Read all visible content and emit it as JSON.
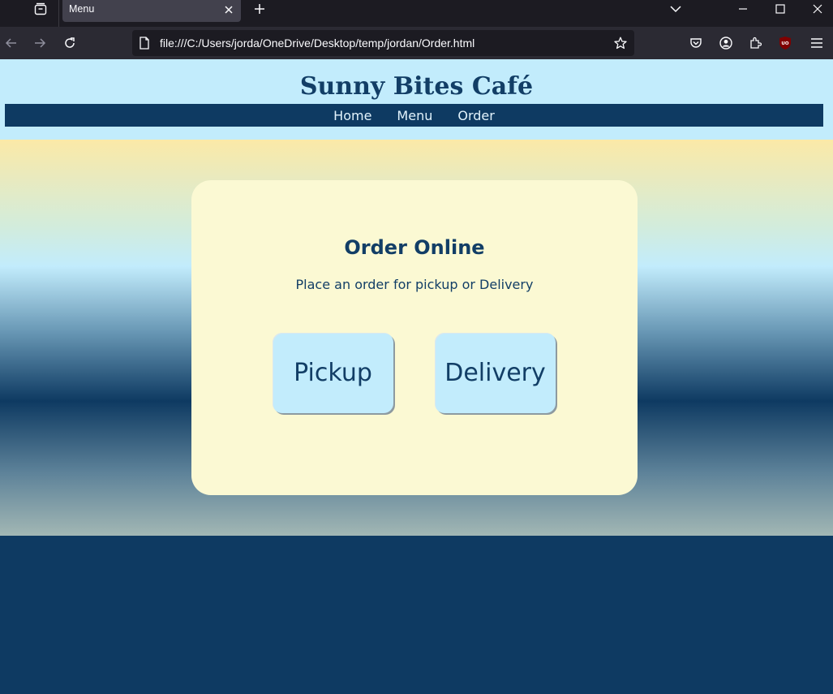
{
  "browser": {
    "tab_title": "Menu",
    "url": "file:///C:/Users/jorda/OneDrive/Desktop/temp/jordan/Order.html",
    "icons": [
      "collections-icon",
      "close-icon",
      "plus-icon",
      "chevron-down-icon",
      "minimize-icon",
      "maximize-icon",
      "window-close-icon",
      "back-arrow-icon",
      "forward-arrow-icon",
      "reload-icon",
      "page-icon",
      "star-icon",
      "pocket-icon",
      "account-icon",
      "extensions-icon",
      "ublock-icon",
      "hamburger-menu-icon"
    ],
    "ublock_label": "UO"
  },
  "site": {
    "title": "Sunny Bites Café",
    "nav": [
      "Home",
      "Menu",
      "Order"
    ]
  },
  "order": {
    "heading": "Order Online",
    "description": "Place an order for pickup or Delivery",
    "pickup_label": "Pickup",
    "delivery_label": "Delivery"
  },
  "colors": {
    "header_bg": "#c2ecfc",
    "navy": "#0e3a62",
    "card_bg": "#fbf9d3",
    "button_bg": "#c2ecfc",
    "text": "#123e66"
  }
}
